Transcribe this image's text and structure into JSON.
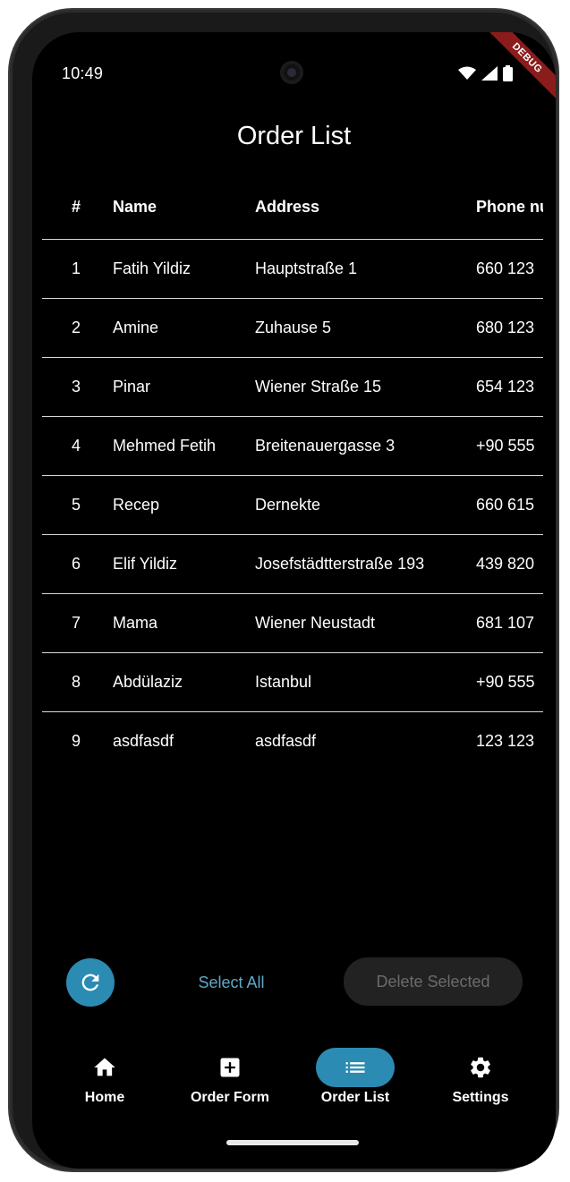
{
  "status_bar": {
    "time": "10:49",
    "debug_label": "DEBUG"
  },
  "page": {
    "title": "Order List"
  },
  "table": {
    "headers": [
      "#",
      "Name",
      "Address",
      "Phone nu"
    ],
    "rows": [
      {
        "idx": "1",
        "name": "Fatih Yildiz",
        "address": "Hauptstraße 1",
        "phone": "660 123"
      },
      {
        "idx": "2",
        "name": "Amine",
        "address": "Zuhause 5",
        "phone": "680 123"
      },
      {
        "idx": "3",
        "name": "Pinar",
        "address": "Wiener Straße 15",
        "phone": "654 123"
      },
      {
        "idx": "4",
        "name": "Mehmed Fetih",
        "address": "Breitenauergasse 3",
        "phone": "+90 555"
      },
      {
        "idx": "5",
        "name": "Recep",
        "address": "Dernekte",
        "phone": "660 615"
      },
      {
        "idx": "6",
        "name": "Elif Yildiz",
        "address": "Josefstädtterstraße 193",
        "phone": "439 820"
      },
      {
        "idx": "7",
        "name": "Mama",
        "address": "Wiener Neustadt",
        "phone": "681 107"
      },
      {
        "idx": "8",
        "name": "Abdülaziz",
        "address": "Istanbul",
        "phone": "+90 555"
      },
      {
        "idx": "9",
        "name": "asdfasdf",
        "address": "asdfasdf",
        "phone": "123 123"
      }
    ]
  },
  "actions": {
    "refresh_icon": "refresh-icon",
    "select_all_label": "Select All",
    "delete_selected_label": "Delete Selected"
  },
  "bottom_nav": {
    "items": [
      {
        "label": "Home",
        "icon": "home-icon",
        "active": false
      },
      {
        "label": "Order Form",
        "icon": "add-box-icon",
        "active": false
      },
      {
        "label": "Order List",
        "icon": "list-icon",
        "active": true
      },
      {
        "label": "Settings",
        "icon": "gear-icon",
        "active": false
      }
    ]
  },
  "colors": {
    "accent": "#2b8bb2",
    "accent_text": "#5fa9c7",
    "background": "#000000",
    "disabled_button": "#222222",
    "disabled_text": "#6b6b6b",
    "debug_ribbon": "#8b1c1c"
  }
}
